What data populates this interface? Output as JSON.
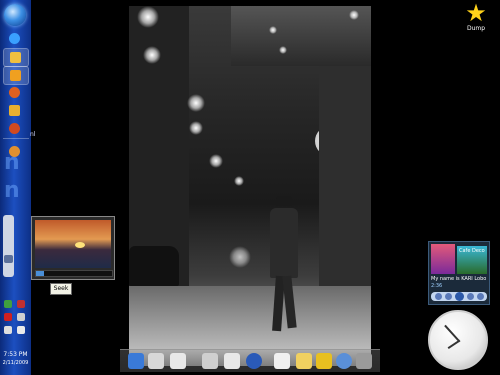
{
  "taskbar": {
    "clock_time": "7:53 PM",
    "clock_date": "2/11/2009",
    "tray_label": "nl"
  },
  "thumbnail": {
    "progress": 0.1,
    "tooltip": "Seek"
  },
  "desktop": {
    "icons": [
      {
        "label": "Dump",
        "icon": "star-icon"
      }
    ]
  },
  "media_player": {
    "cover_title": "Cafe Deco",
    "track_title": "My name is KARI Lobo",
    "time": "2:36"
  },
  "clock_gadget": {
    "hour": 7,
    "minute": 53
  },
  "colors": {
    "taskbar": "#1c4fc0",
    "star": "#ffd21a"
  }
}
